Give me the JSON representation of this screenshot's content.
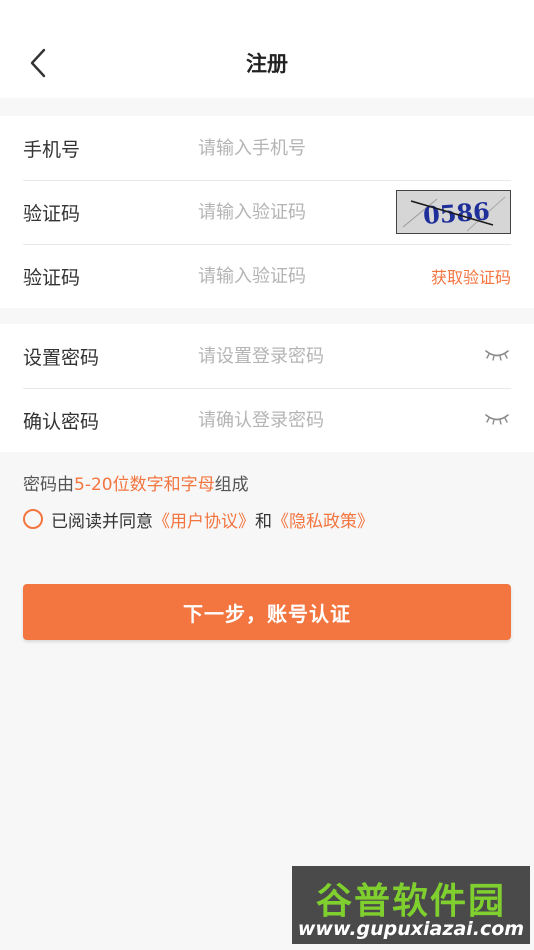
{
  "header": {
    "title": "注册",
    "back_icon": "chevron-left-icon"
  },
  "account": {
    "phone": {
      "label": "手机号",
      "placeholder": "请输入手机号",
      "value": ""
    },
    "image_code": {
      "label": "验证码",
      "placeholder": "请输入验证码",
      "value": "",
      "captcha_text": "0586"
    },
    "sms_code": {
      "label": "验证码",
      "placeholder": "请输入验证码",
      "value": "",
      "action_label": "获取验证码"
    }
  },
  "password": {
    "set": {
      "label": "设置密码",
      "placeholder": "请设置登录密码",
      "value": "",
      "toggle_icon": "eye-closed-icon"
    },
    "confirm": {
      "label": "确认密码",
      "placeholder": "请确认登录密码",
      "value": "",
      "toggle_icon": "eye-closed-icon"
    }
  },
  "rule": {
    "prefix": "密码由",
    "highlight": "5-20位数字和字母",
    "suffix": "组成"
  },
  "agreement": {
    "checked": false,
    "prefix": "已阅读并同意",
    "user_agreement": "《用户协议》",
    "connector": "和",
    "privacy_policy": "《隐私政策》"
  },
  "next_button": {
    "label": "下一步，账号认证"
  },
  "watermark": {
    "title": "谷普软件园",
    "url": "www.gupuxiazai.com"
  },
  "colors": {
    "accent": "#f37540",
    "background": "#f7f7f7",
    "card": "#ffffff",
    "placeholder": "#b4b4b4",
    "text": "#333333"
  }
}
